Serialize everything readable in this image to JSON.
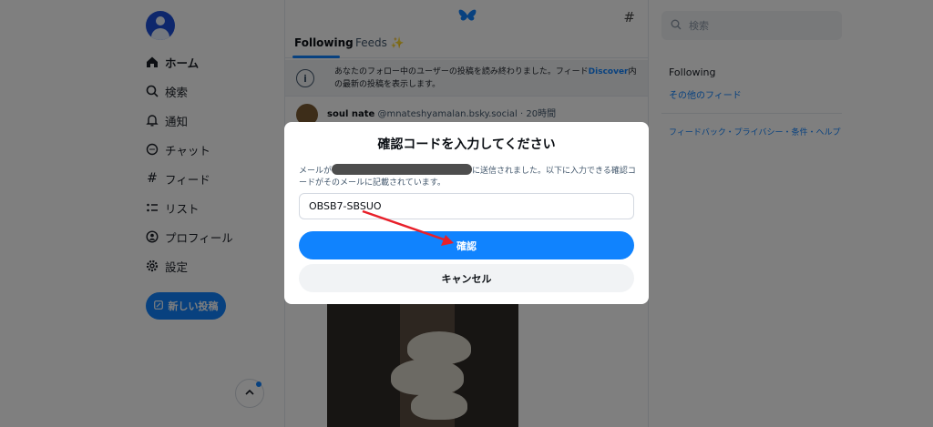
{
  "nav": {
    "items": [
      {
        "label": "ホーム",
        "icon": "home-icon",
        "active": true
      },
      {
        "label": "検索",
        "icon": "search-icon"
      },
      {
        "label": "通知",
        "icon": "bell-icon"
      },
      {
        "label": "チャット",
        "icon": "chat-icon"
      },
      {
        "label": "フィード",
        "icon": "hash-icon"
      },
      {
        "label": "リスト",
        "icon": "list-icon"
      },
      {
        "label": "プロフィール",
        "icon": "profile-icon"
      },
      {
        "label": "設定",
        "icon": "gear-icon"
      }
    ],
    "new_post_label": "新しい投稿"
  },
  "feed": {
    "tabs": [
      "Following",
      "Feeds ✨"
    ],
    "notice_before": "あなたのフォロー中のユーザーの投稿を読み終わりました。フィード",
    "notice_link": "Discover",
    "notice_after": "内の最新の投稿を表示します。",
    "post": {
      "author": "soul nate",
      "handle": "@mnateshyamalan.bsky.social",
      "time": "· 20時間"
    }
  },
  "right": {
    "search_placeholder": "検索",
    "section_title": "Following",
    "more_feeds": "その他のフィード",
    "footer": "フィードバック・プライバシー・条件・ヘルプ"
  },
  "modal": {
    "title": "確認コードを入力してください",
    "desc_before": "メールが",
    "desc_after": "に送信されました。以下に入力できる確認コードがそのメールに記載されています。",
    "code_value": "OBSB7-SBSUO",
    "confirm_label": "確認",
    "cancel_label": "キャンセル"
  },
  "colors": {
    "accent": "#1083fe",
    "annotation_arrow": "#e8202a"
  }
}
